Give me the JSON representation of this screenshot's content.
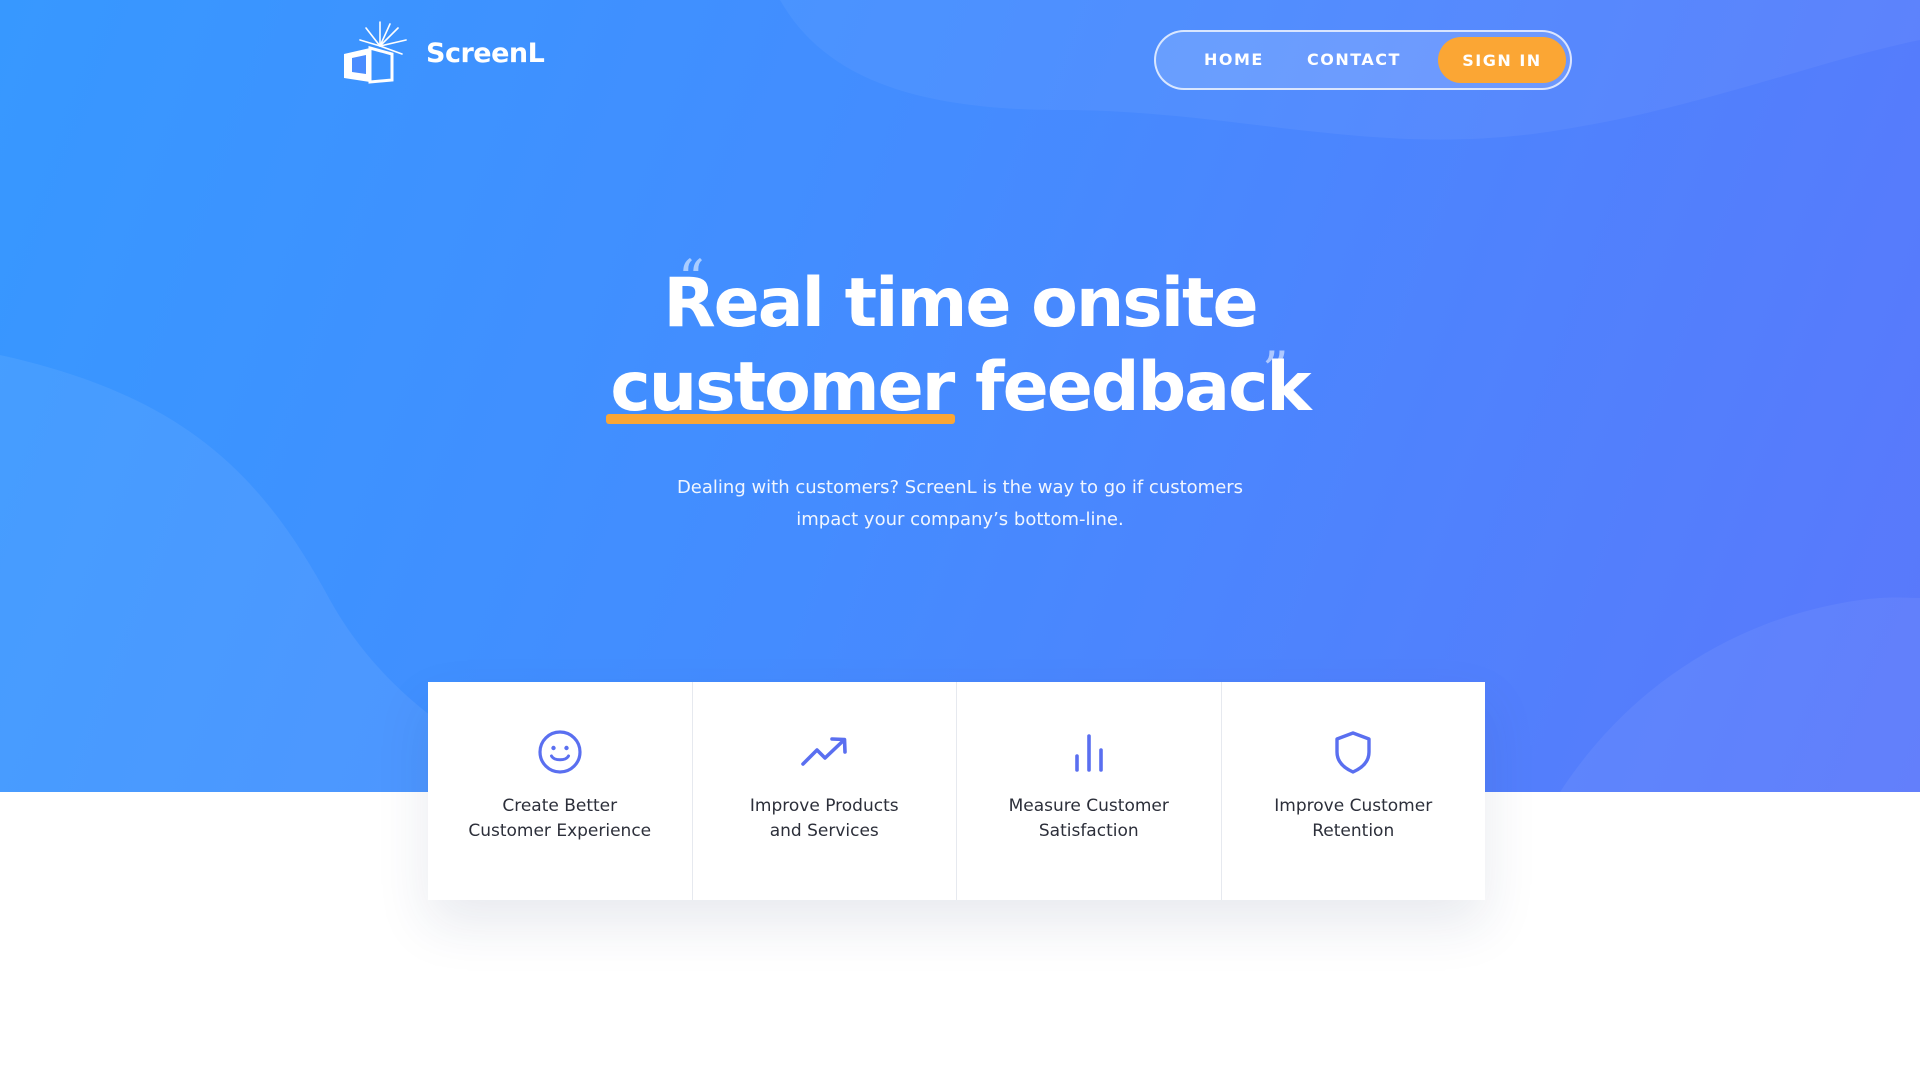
{
  "brand": {
    "name": "ScreenL",
    "logo_icon": "box-burst-icon"
  },
  "nav": {
    "home_label": "HOME",
    "contact_label": "CONTACT",
    "signin_label": "SIGN IN"
  },
  "hero": {
    "headline_line1": "Real time onsite",
    "headline_highlight": "customer",
    "headline_rest": " feedback",
    "quote_open": "“",
    "quote_close": "”",
    "subtitle_line1": "Dealing with customers? ScreenL is the way to go if customers",
    "subtitle_line2": "impact your company’s bottom-line."
  },
  "features": [
    {
      "icon": "smile-icon",
      "line1": "Create Better",
      "line2": "Customer Experience"
    },
    {
      "icon": "trending-up-icon",
      "line1": "Improve Products",
      "line2": "and Services"
    },
    {
      "icon": "bar-chart-icon",
      "line1": "Measure Customer",
      "line2": "Satisfaction"
    },
    {
      "icon": "shield-icon",
      "line1": "Improve Customer",
      "line2": "Retention"
    }
  ],
  "colors": {
    "hero_start": "#3798ff",
    "hero_end": "#5a78fb",
    "accent": "#fba634",
    "icon": "#5a6ff0",
    "text_dark": "#2c2f3a"
  }
}
